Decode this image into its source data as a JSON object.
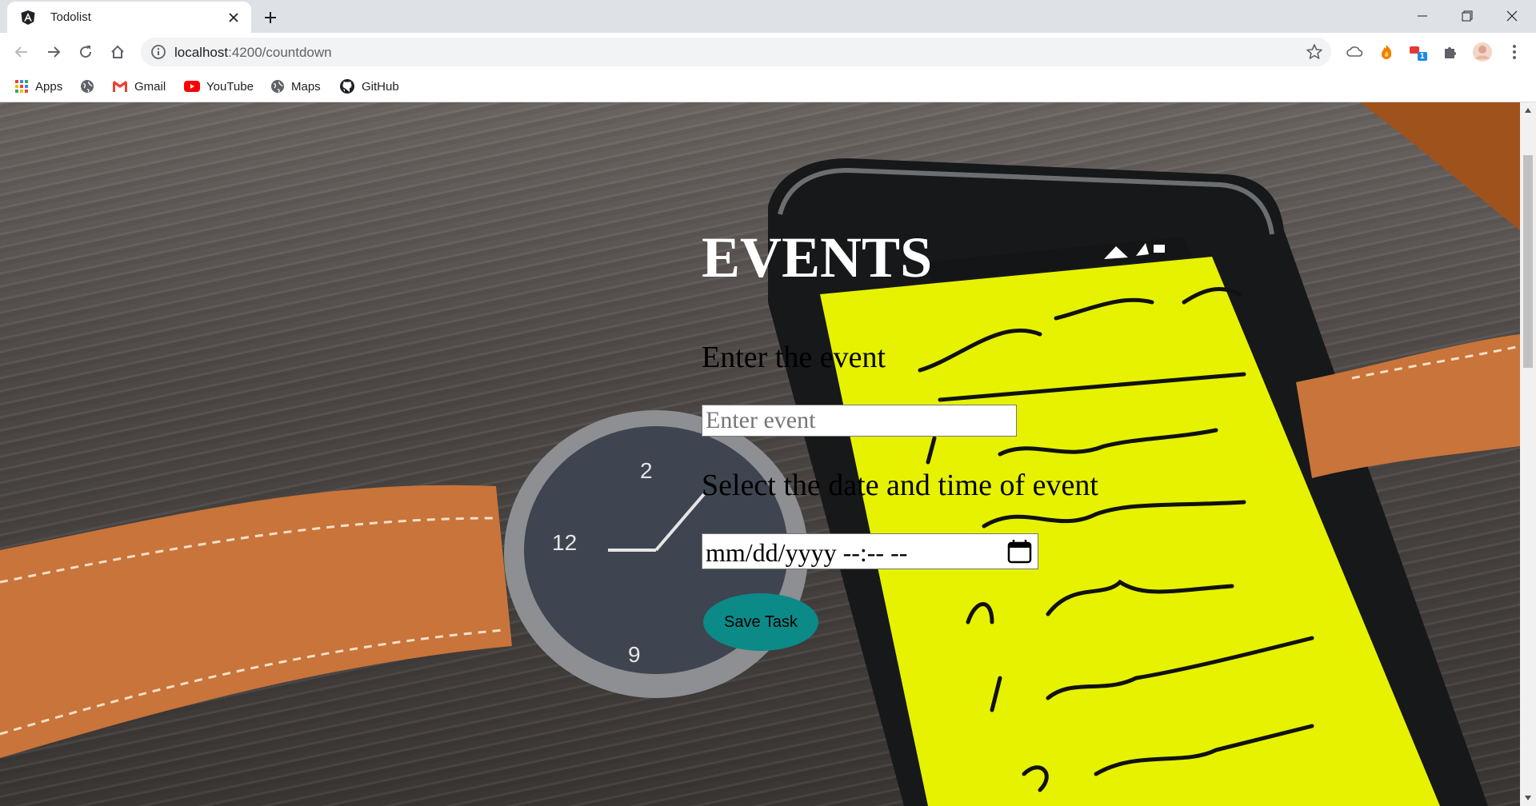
{
  "browser": {
    "tab_title": "Todolist",
    "url_host": "localhost",
    "url_rest": ":4200/countdown",
    "bookmarks": [
      {
        "label": "Apps",
        "icon": "apps-grid-icon"
      },
      {
        "label": "",
        "icon": "globe-icon"
      },
      {
        "label": "Gmail",
        "icon": "gmail-icon"
      },
      {
        "label": "YouTube",
        "icon": "youtube-icon"
      },
      {
        "label": "Maps",
        "icon": "globe-icon"
      },
      {
        "label": "GitHub",
        "icon": "github-icon"
      }
    ],
    "extension_badge": "1"
  },
  "page": {
    "title": "EVENTS",
    "event_label": "Enter the event",
    "event_placeholder": "Enter event",
    "event_value": "",
    "date_label": "Select the date and time of event",
    "date_placeholder": "mm/dd/yyyy --:-- --",
    "save_label": "Save Task"
  },
  "colors": {
    "save_button": "#0b8a88",
    "title": "#ffffff"
  }
}
